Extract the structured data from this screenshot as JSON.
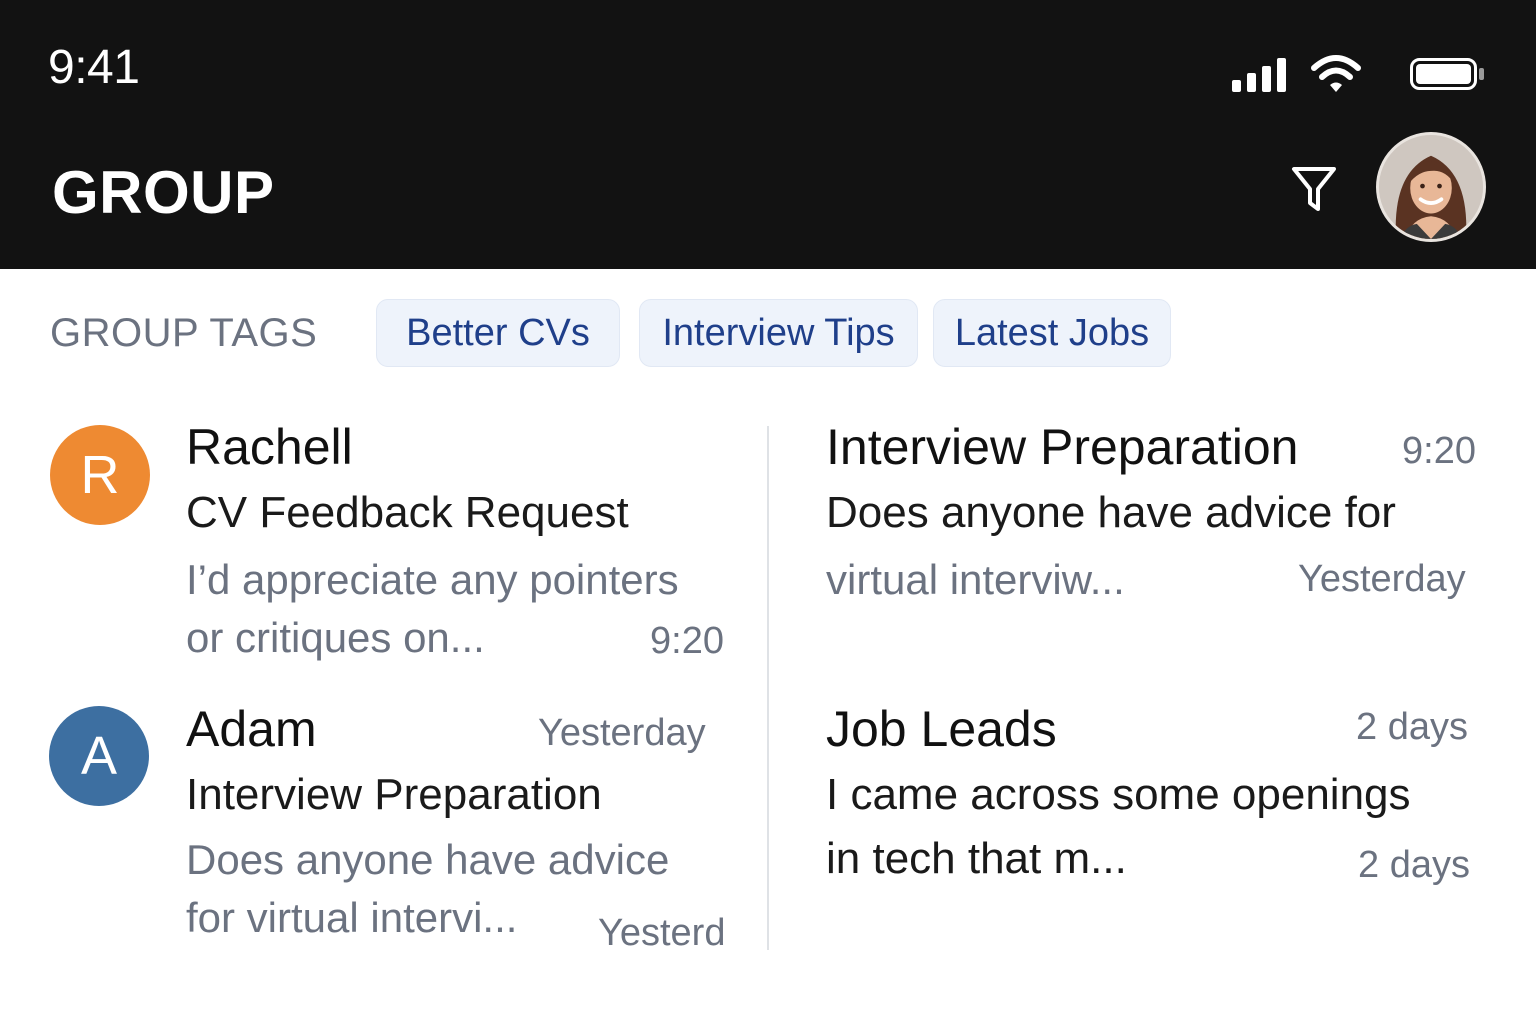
{
  "status_bar": {
    "time": "9:41",
    "icons": [
      "signal-icon",
      "wifi-icon",
      "battery-icon"
    ]
  },
  "header": {
    "title": "GROUP",
    "filter_icon": "filter-icon",
    "background": "#121212"
  },
  "tags": {
    "label": "GROUP TAGS",
    "items": [
      "Better CVs",
      "Interview Tips",
      "Latest Jobs"
    ],
    "accent": "#1f3f8a"
  },
  "messages_left": [
    {
      "avatar_letter": "R",
      "avatar_color": "#ee8a32",
      "sender": "Rachell",
      "subject": "CV Feedback Request",
      "preview_line1": "I’d appreciate any pointers",
      "preview_line2": "or critiques on...",
      "time": "9:20"
    },
    {
      "avatar_letter": "A",
      "avatar_color": "#3d6fa1",
      "sender": "Adam",
      "sender_time": "Yesterday",
      "subject": "Interview Preparation",
      "preview_line1": "Does anyone have advice",
      "preview_line2": "for virtual intervi...",
      "time": "Yesterd"
    }
  ],
  "messages_right": [
    {
      "title": "Interview Preparation",
      "title_time": "9:20",
      "preview_line1": "Does anyone have advice for",
      "preview_line2": "virtual interviw...",
      "time": "Yesterday"
    },
    {
      "title": "Job Leads",
      "title_time": "2 days",
      "preview_line1": "I came across some openings",
      "preview_line2": "in tech that m...",
      "time": "2 days"
    }
  ]
}
